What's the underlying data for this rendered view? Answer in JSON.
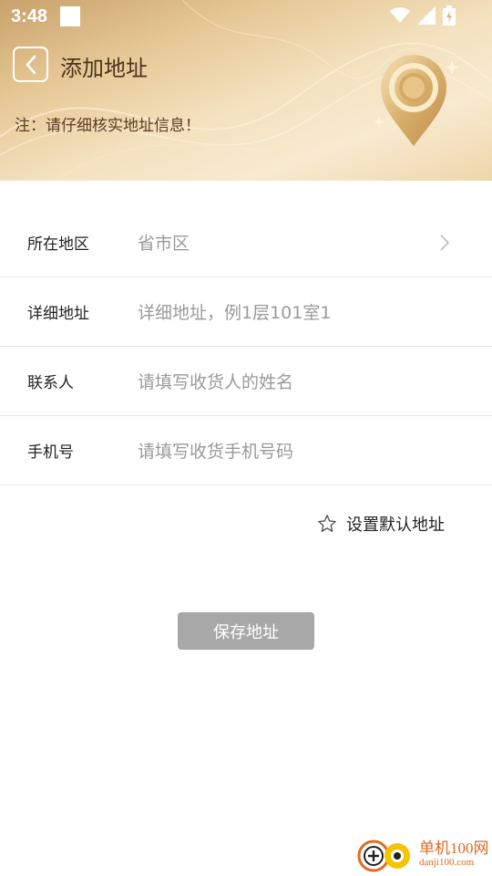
{
  "status_bar": {
    "time": "3:48",
    "icons": [
      "wifi-icon",
      "signal-icon",
      "battery-charging-icon"
    ]
  },
  "header": {
    "title": "添加地址",
    "notice": "注：请仔细核实地址信息！",
    "accent_color": "#c9a16b"
  },
  "form": {
    "region": {
      "label": "所在地区",
      "value": "省市区"
    },
    "detail": {
      "label": "详细地址",
      "placeholder": "详细地址，例1层101室1"
    },
    "contact": {
      "label": "联系人",
      "placeholder": "请填写收货人的姓名"
    },
    "phone": {
      "label": "手机号",
      "placeholder": "请填写收货手机号码"
    }
  },
  "default_address": {
    "label": "设置默认地址",
    "checked": false
  },
  "save_button": {
    "label": "保存地址",
    "color": "#a8a8a8"
  },
  "watermark": {
    "name": "单机100网",
    "url": "danji100.com"
  }
}
